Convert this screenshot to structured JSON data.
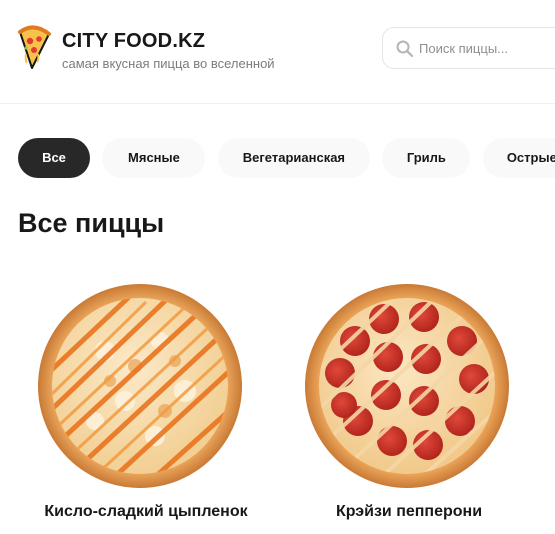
{
  "brand": {
    "title": "CITY FOOD.KZ",
    "subtitle": "самая вкусная пицца во вселенной",
    "logo_icon": "pizza-slice-icon"
  },
  "search": {
    "placeholder": "Поиск пиццы...",
    "value": "",
    "icon": "search-icon"
  },
  "categories": [
    {
      "label": "Все",
      "active": true
    },
    {
      "label": "Мясные",
      "active": false
    },
    {
      "label": "Вегетарианская",
      "active": false
    },
    {
      "label": "Гриль",
      "active": false
    },
    {
      "label": "Острые",
      "active": false
    }
  ],
  "section": {
    "title": "Все пиццы"
  },
  "pizzas": [
    {
      "name": "Кисло-сладкий цыпленок",
      "image": "pizza-chicken-image"
    },
    {
      "name": "Крэйзи пепперони",
      "image": "pizza-pepperoni-image"
    }
  ],
  "colors": {
    "accent_dark": "#282828",
    "chip_bg": "#f9f9f9",
    "text": "#181818",
    "muted": "#7b7b7b"
  }
}
